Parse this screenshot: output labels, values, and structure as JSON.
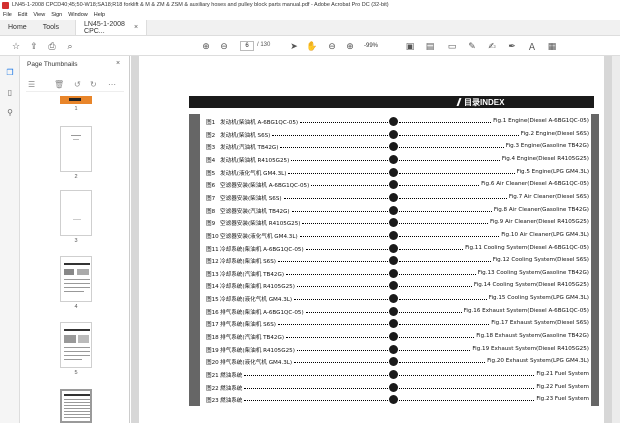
{
  "window": {
    "title": "LN45-1-2008 CPCD40;45;50-W18;SA18;R18 forklift & M & ZM & ZSM & auxiliary hoses and pulley block parts manual.pdf - Adobe Acrobat Pro DC (32-bit)"
  },
  "menu": [
    "File",
    "Edit",
    "View",
    "Sign",
    "Window",
    "Help"
  ],
  "tabs": {
    "home": "Home",
    "tools": "Tools",
    "doc": "LN45-1-2008 CPC...",
    "close": "×"
  },
  "toolbar": {
    "page_current": "6",
    "page_total": "/ 130",
    "zoom": "-99%"
  },
  "panel": {
    "title": "Page Thumbnails",
    "close": "×",
    "thumb_labels": [
      "1",
      "2",
      "3",
      "4",
      "5",
      ""
    ]
  },
  "index": {
    "header": "目录INDEX",
    "rows": [
      {
        "fig": "图1",
        "cn": "发动机(柴油机 A-6BG1QC-05)",
        "en": "Fig.1 Engine(Diesel A-6BG1QC-05)"
      },
      {
        "fig": "图2",
        "cn": "发动机(柴油机 S6S)",
        "en": "Fig.2 Engine(Diesel S6S)"
      },
      {
        "fig": "图3",
        "cn": "发动机(汽油机 TB42G)",
        "en": "Fig.3 Engine(Gasoline TB42G)"
      },
      {
        "fig": "图4",
        "cn": "发动机(柴油机 R4105G25)",
        "en": "Fig.4 Engine(Diesel R4105G25)"
      },
      {
        "fig": "图5",
        "cn": "发动机(液化气机 GM4.3L)",
        "en": "Fig.5 Engine(LPG GM4.3L)"
      },
      {
        "fig": "图6",
        "cn": "空滤器安装(柴油机 A-6BG1QC-05)",
        "en": "Fig.6 Air Cleaner(Diesel A-6BG1QC-05)"
      },
      {
        "fig": "图7",
        "cn": "空滤器安装(柴油机 S6S)",
        "en": "Fig.7 Air Cleaner(Diesel S6S)"
      },
      {
        "fig": "图8",
        "cn": "空滤器安装(汽油机 TB42G)",
        "en": "Fig.8 Air Cleaner(Gasoline TB42G)"
      },
      {
        "fig": "图9",
        "cn": "空滤器安装(柴油机 R4105G25)",
        "en": "Fig.9 Air Cleaner(Diesel R4105G25)"
      },
      {
        "fig": "图10",
        "cn": "空滤器安装(液化气机 GM4.3L)",
        "en": "Fig.10 Air Cleaner(LPG GM4.3L)"
      },
      {
        "fig": "图11",
        "cn": "冷却系统(柴油机 A-6BG1QC-05)",
        "en": "Fig.11 Cooling System(Diesel A-6BG1QC-05)"
      },
      {
        "fig": "图12",
        "cn": "冷却系统(柴油机 S6S)",
        "en": "Fig.12 Cooling System(Diesel S6S)"
      },
      {
        "fig": "图13",
        "cn": "冷却系统(汽油机 TB42G)",
        "en": "Fig.13 Cooling System(Gasoline TB42G)"
      },
      {
        "fig": "图14",
        "cn": "冷却系统(柴油机 R4105G25)",
        "en": "Fig.14 Cooling System(Diesel R4105G25)"
      },
      {
        "fig": "图15",
        "cn": "冷却系统(液化气机 GM4.3L)",
        "en": "Fig.15 Cooling System(LPG GM4.3L)"
      },
      {
        "fig": "图16",
        "cn": "排气系统(柴油机 A-6BG1QC-05)",
        "en": "Fig.16 Exhaust System(Diesel A-6BG1QC-05)"
      },
      {
        "fig": "图17",
        "cn": "排气系统(柴油机 S6S)",
        "en": "Fig.17 Exhaust System(Diesel S6S)"
      },
      {
        "fig": "图18",
        "cn": "排气系统(汽油机 TB42G)",
        "en": "Fig.18 Exhaust System(Gasoline TB42G)"
      },
      {
        "fig": "图19",
        "cn": "排气系统(柴油机 R4105G25)",
        "en": "Fig.19 Exhaust System(Diesel R4105G25)"
      },
      {
        "fig": "图20",
        "cn": "排气系统(液化气机 GM4.3L)",
        "en": "Fig.20 Exhaust System(LPG GM4.3L)"
      },
      {
        "fig": "图21",
        "cn": "燃油系统",
        "en": "Fig.21 Fuel System"
      },
      {
        "fig": "图22",
        "cn": "燃油系统",
        "en": "Fig.22 Fuel System"
      },
      {
        "fig": "图23",
        "cn": "燃油系统",
        "en": "Fig.23 Fuel System"
      }
    ]
  }
}
